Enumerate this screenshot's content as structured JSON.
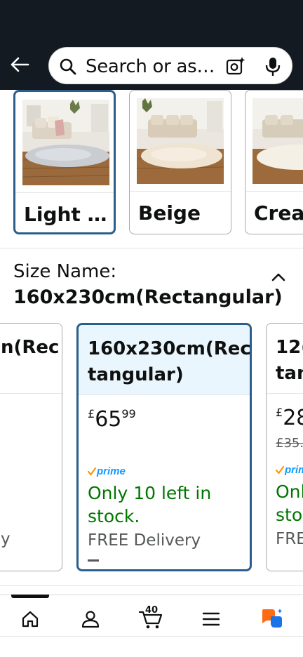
{
  "header": {
    "search_placeholder": "Search or as…"
  },
  "color_options": [
    {
      "label": "Light …",
      "selected": true,
      "swatch_tone": "#c9ccd0"
    },
    {
      "label": "Beige",
      "selected": false,
      "swatch_tone": "#efe3d1"
    },
    {
      "label": "Crean",
      "selected": false,
      "swatch_tone": "#f4f0e6"
    }
  ],
  "size_section": {
    "heading": "Size Name:",
    "selected_value": "160x230cm(Rectangular)"
  },
  "size_cards": [
    {
      "title_line1": "n(Rec",
      "title_line2": "",
      "delivery_tail": "y"
    },
    {
      "title_line1": "160x230cm(Rec",
      "title_line2": "tangular)",
      "price_currency": "£",
      "price_whole": "65",
      "price_fraction": "99",
      "prime_label": "prime",
      "stock": "Only 10 left in stock.",
      "delivery": "FREE Delivery",
      "selected": true
    },
    {
      "title_line1": "12(",
      "title_line2": "tan",
      "price_currency": "£",
      "price_whole": "28",
      "was_price": "£35.",
      "prime_label": "prim",
      "stock_line1": "Onl",
      "stock_line2": "sto",
      "delivery": "FRE"
    }
  ],
  "bottom_nav": {
    "cart_count": "40",
    "items": [
      "home-icon",
      "account-icon",
      "cart-icon",
      "menu-icon",
      "rufus-icon"
    ]
  },
  "colors": {
    "header_bg": "#131a22",
    "selected_border": "#2a5e8c",
    "in_stock_green": "#007600",
    "prime_blue": "#1399ff",
    "accent_orange": "#ff6a13"
  }
}
